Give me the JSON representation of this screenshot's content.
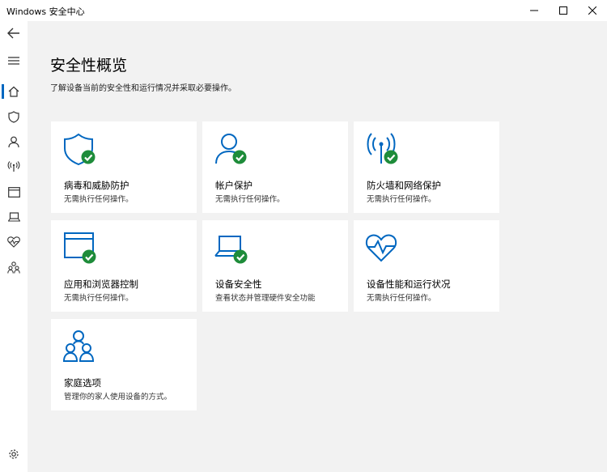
{
  "window": {
    "title": "Windows 安全中心"
  },
  "header": {
    "title": "安全性概览",
    "subtitle": "了解设备当前的安全性和运行情况并采取必要操作。"
  },
  "nav": {
    "items": [
      "back-icon",
      "menu-icon",
      "home-icon",
      "shield-icon",
      "person-icon",
      "wireless-icon",
      "browser-window-icon",
      "laptop-icon",
      "heart-pulse-icon",
      "family-icon",
      "gear-icon"
    ],
    "active": "home"
  },
  "tiles": [
    {
      "title": "病毒和威胁防护",
      "status": "无需执行任何操作。",
      "icon": "shield-icon",
      "ok": true
    },
    {
      "title": "帐户保护",
      "status": "无需执行任何操作。",
      "icon": "person-icon",
      "ok": true
    },
    {
      "title": "防火墙和网络保护",
      "status": "无需执行任何操作。",
      "icon": "wireless-icon",
      "ok": true
    },
    {
      "title": "应用和浏览器控制",
      "status": "无需执行任何操作。",
      "icon": "browser-window-icon",
      "ok": true
    },
    {
      "title": "设备安全性",
      "status": "查看状态并管理硬件安全功能",
      "icon": "laptop-icon",
      "ok": true
    },
    {
      "title": "设备性能和运行状况",
      "status": "无需执行任何操作。",
      "icon": "heart-pulse-icon",
      "ok": false
    },
    {
      "title": "家庭选项",
      "status": "管理你的家人使用设备的方式。",
      "icon": "family-icon",
      "ok": false
    }
  ],
  "colors": {
    "accent": "#0067c0",
    "ok_badge": "#1e8c3a",
    "content_bg": "#f2f2f2"
  }
}
